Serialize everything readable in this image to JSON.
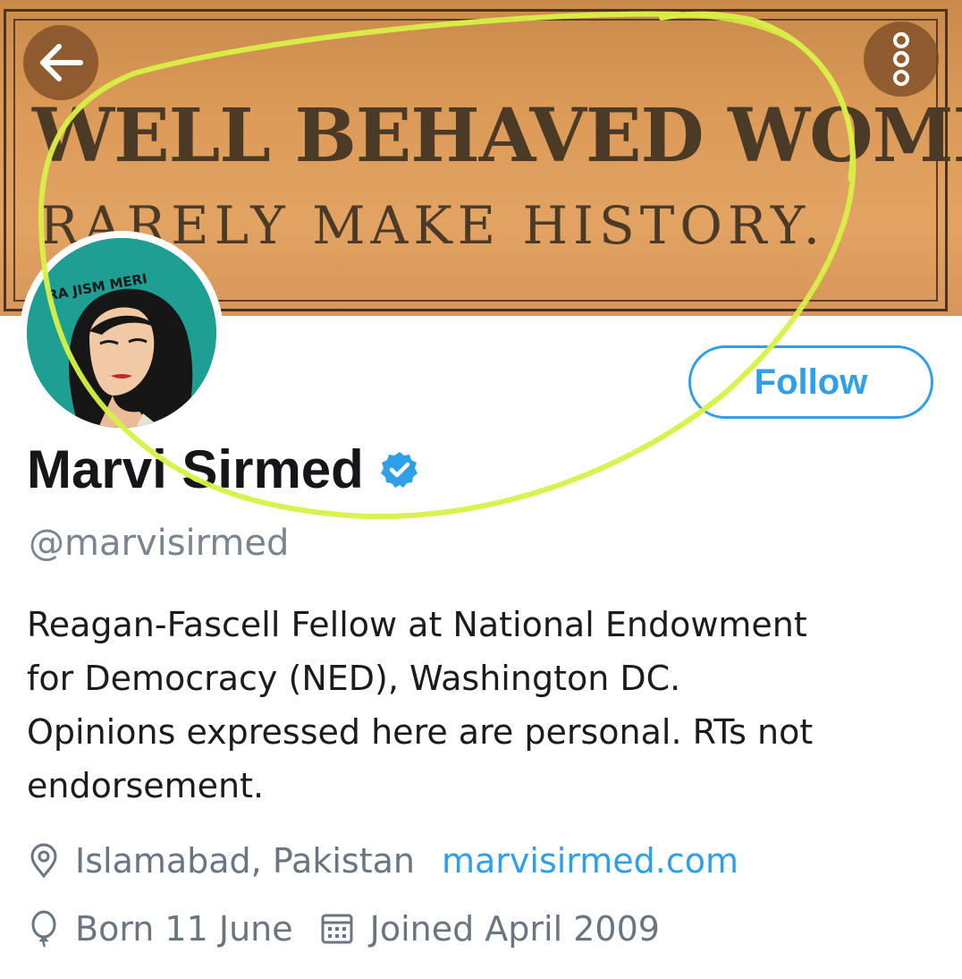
{
  "banner": {
    "plaque_line1": "WELL BEHAVED WOMEN",
    "plaque_line2": "RARELY MAKE HISTORY.",
    "avatar_caption": "RA JISM MERI"
  },
  "nav": {
    "back_icon": "arrow-left-icon",
    "more_icon": "vertical-dots-icon"
  },
  "profile": {
    "follow_label": "Follow",
    "name": "Marvi Sirmed",
    "handle": "@marvisirmed",
    "bio_lines": [
      "Reagan-Fascell Fellow at National Endowment",
      "for Democracy (NED), Washington DC.",
      "Opinions expressed here are personal. RTs not",
      "endorsement."
    ],
    "location": "Islamabad, Pakistan",
    "website": "marvisirmed.com",
    "birthday": "Born 11 June",
    "joined": "Joined April 2009"
  },
  "colors": {
    "accent": "#2f9fe8",
    "muted": "#697580",
    "annotation": "#d8f046",
    "banner": "#dc9a58",
    "avatar_bg": "#1f9e93"
  }
}
